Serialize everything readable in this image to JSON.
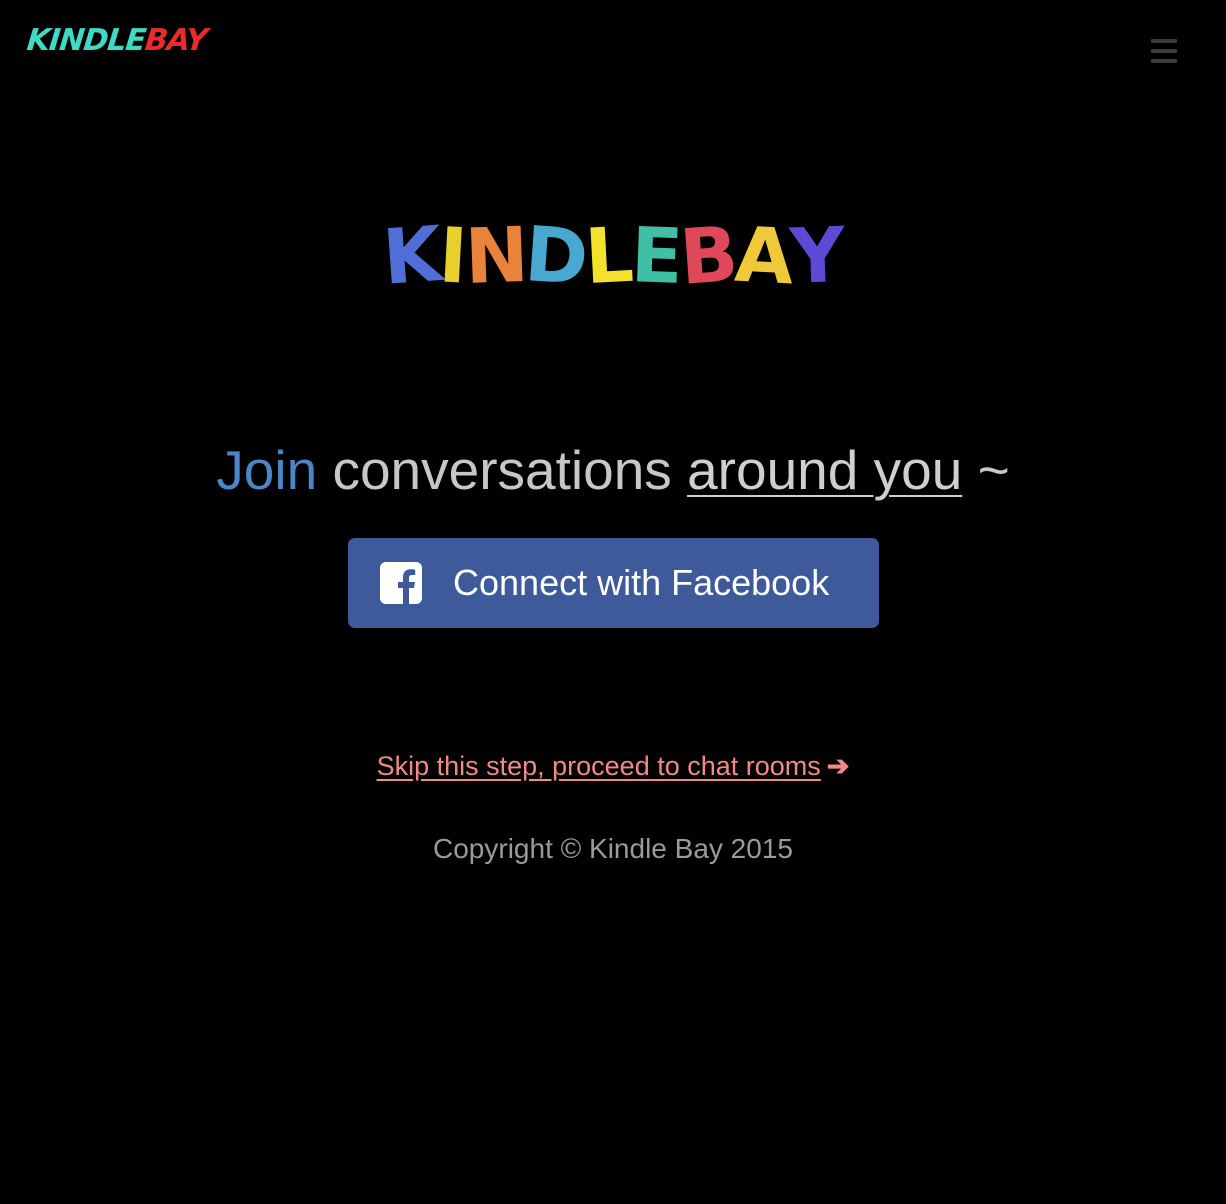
{
  "header": {
    "logo_part_a": "KINDLE",
    "logo_part_b": "BAY"
  },
  "hero": {
    "logo_letters": [
      "K",
      "I",
      "N",
      "D",
      "L",
      "E",
      "B",
      "A",
      "Y"
    ],
    "logo_colors": [
      "#4f6fd6",
      "#e9cf2c",
      "#e9823a",
      "#49a8cf",
      "#f3e12c",
      "#3ebfa6",
      "#e0485a",
      "#f0c93a",
      "#5a4ad4"
    ]
  },
  "tagline": {
    "join": "Join",
    "conversations": "conversations",
    "around_you": "around you",
    "tilde": "~"
  },
  "facebook_button": {
    "label": "Connect with Facebook",
    "icon": "facebook-icon",
    "color": "#3f5a9a"
  },
  "skip_link": {
    "label": "Skip this step, proceed to chat rooms",
    "arrow": "➔",
    "color": "#f08b84"
  },
  "footer": {
    "copyright": "Copyright © Kindle Bay 2015"
  },
  "menu": {
    "icon": "hamburger-menu-icon"
  }
}
